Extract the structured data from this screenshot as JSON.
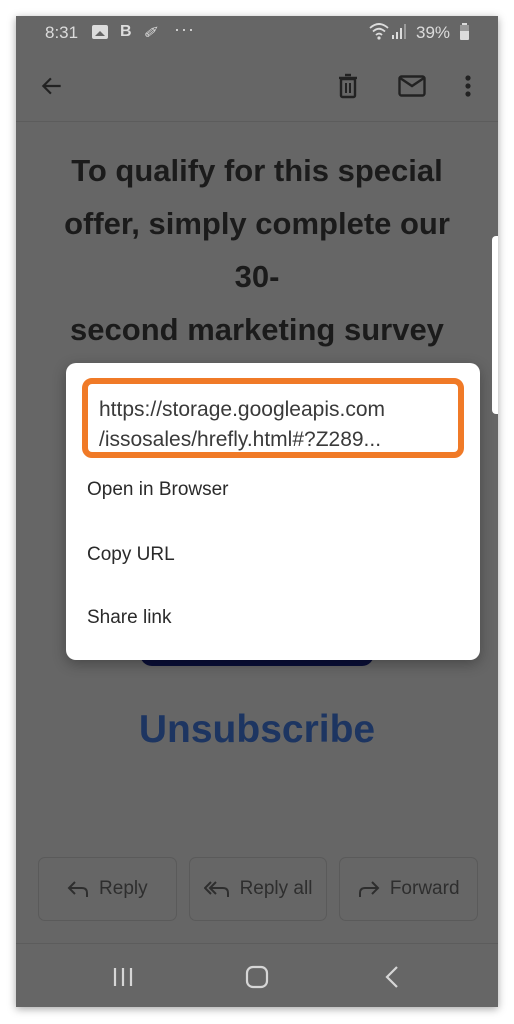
{
  "status_bar": {
    "time": "8:31",
    "left_icons": [
      "image-icon",
      "b-icon",
      "pen-icon",
      "more-notifications-icon"
    ],
    "b_glyph": "B",
    "pen_glyph": "✐",
    "more_glyph": "···",
    "battery_percent": "39%",
    "right_icons": [
      "wifi-icon",
      "signal-icon",
      "battery-icon"
    ]
  },
  "app_bar": {
    "icons": [
      "back-arrow-icon",
      "delete-icon",
      "mark-unread-icon",
      "more-vert-icon"
    ]
  },
  "email": {
    "headline_lines": [
      "To qualify for this special",
      "offer, simply complete our",
      "30-",
      "second marketing survey"
    ],
    "unsubscribe_label": "Unsubscribe",
    "cta_button_color": "#0a0f38",
    "unsubscribe_color": "#1d3561"
  },
  "dialog": {
    "url_lines": [
      "https://storage.googleapis.com",
      "/issosales/hrefly.html#?Z289..."
    ],
    "highlight_color": "#f07a27",
    "menu_items": [
      {
        "label": "Open in Browser"
      },
      {
        "label": "Copy URL"
      },
      {
        "label": "Share link"
      }
    ]
  },
  "actions": [
    {
      "label": "Reply",
      "icon": "reply-icon"
    },
    {
      "label": "Reply all",
      "icon": "reply-all-icon"
    },
    {
      "label": "Forward",
      "icon": "forward-icon"
    }
  ],
  "nav_bar": {
    "icons": [
      "recents-icon",
      "home-icon",
      "back-icon"
    ]
  }
}
